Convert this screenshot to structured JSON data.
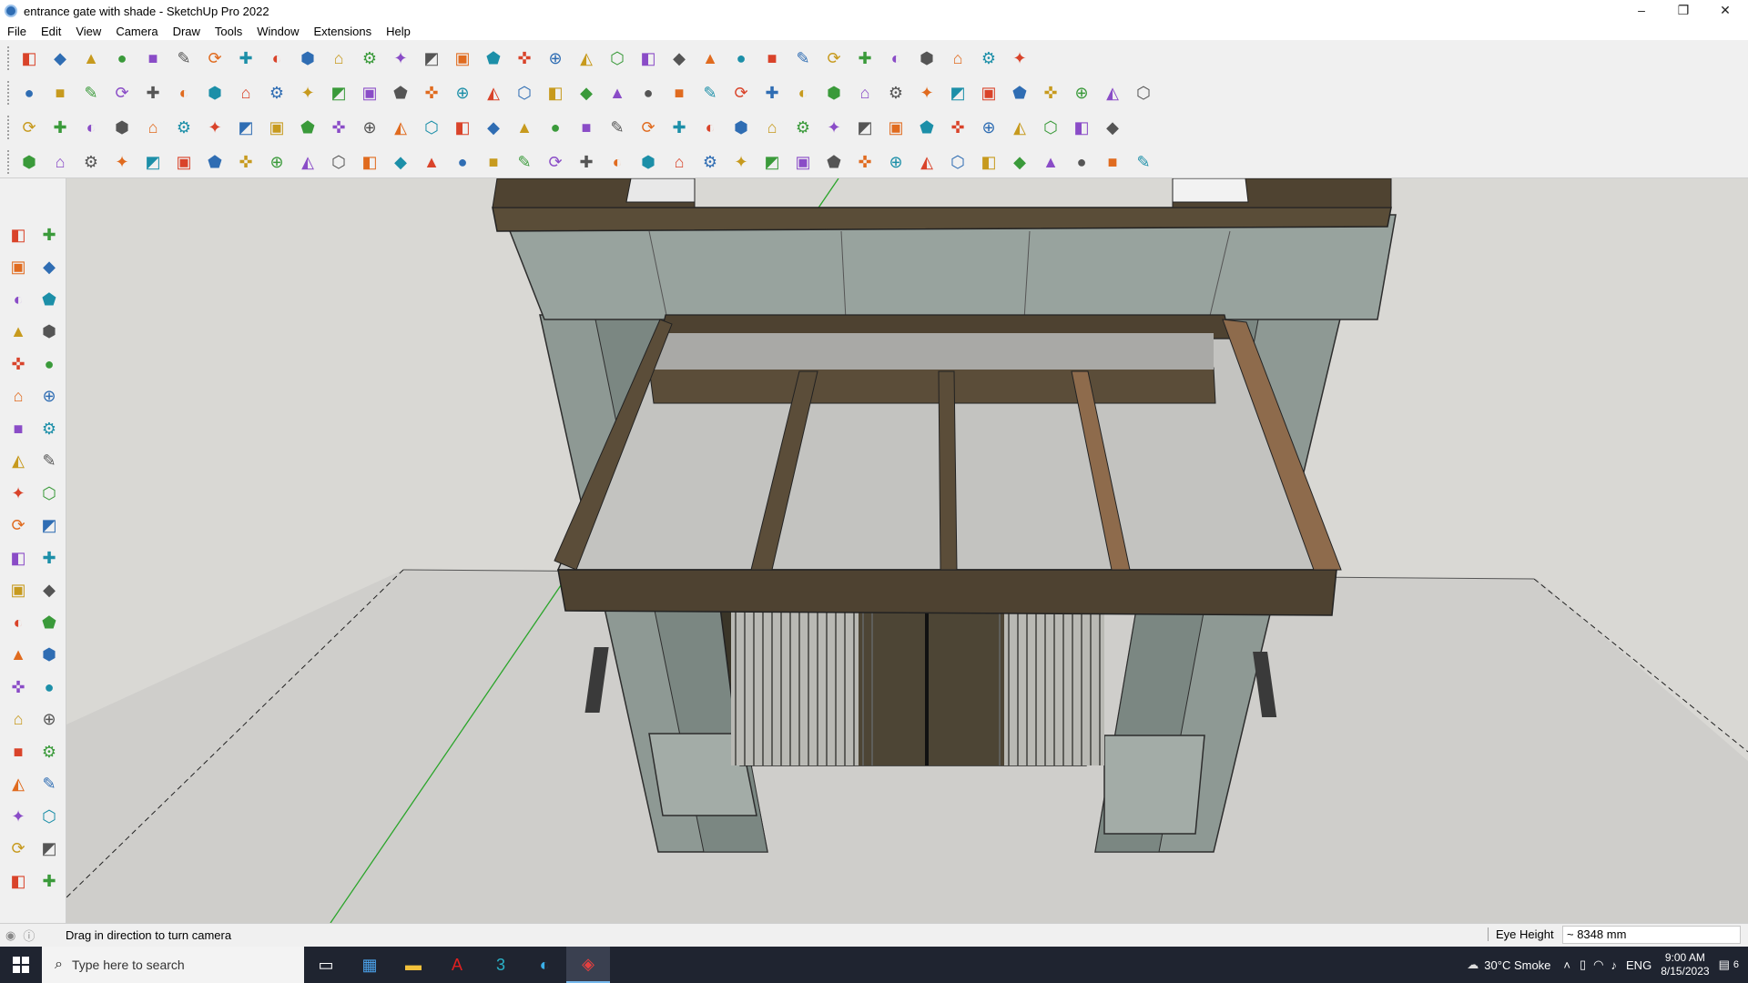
{
  "window": {
    "title": "entrance gate with shade - SketchUp Pro 2022",
    "minimize": "–",
    "maximize": "❐",
    "close": "✕"
  },
  "menu": [
    "File",
    "Edit",
    "View",
    "Camera",
    "Draw",
    "Tools",
    "Window",
    "Extensions",
    "Help"
  ],
  "toolbar_rows": [
    [
      "zoom-extents-icon",
      "select-icon",
      "eraser-icon",
      "pencil-icon",
      "lasso-icon",
      "paint-bucket-icon",
      "push-pull-icon",
      "follow-me-icon",
      "move-icon",
      "rotate-icon",
      "scale-icon",
      "tape-measure-icon",
      "text-icon",
      "paint-icon",
      "orbit-icon",
      "pan-icon",
      "zoom-icon",
      "zoom-window-icon",
      "section-icon",
      "layers-icon",
      "styles-icon",
      "scenes-icon",
      "user-icon",
      "warehouse-icon",
      "extension-warehouse-icon",
      "sandbox-icon",
      "flip-icon",
      "up-down-icon",
      "axes-icon",
      "dimension-icon",
      "undo-icon",
      "redo-icon",
      "hand-icon"
    ],
    [
      "box-icon",
      "component-icon",
      "group-icon",
      "solid-tools-icon",
      "union-icon",
      "subtract-icon",
      "intersect-icon",
      "trim-icon",
      "split-icon",
      "outer-shell-icon",
      "sandbox-from-contours-icon",
      "section-plane-icon",
      "section-cut-icon",
      "house-icon",
      "house-outline-icon",
      "garage-icon",
      "shed-icon",
      "grid-icon",
      "leaf-icon",
      "knife-icon",
      "curve-icon",
      "circle-icon",
      "polygon-icon",
      "ellipse-icon",
      "parallelogram-icon",
      "arc-icon",
      "bezier-icon",
      "lasso-select-icon",
      "paint-tool-icon",
      "magic-eraser-icon",
      "roof-icon",
      "grid-panel-icon",
      "stairs-icon",
      "fence-icon",
      "door-icon",
      "window-icon",
      "texture-icon"
    ],
    [
      "dimension-face-icon",
      "plane-icon",
      "hip-icon",
      "text-label-icon",
      "tag-icon",
      "frame-icon",
      "spring-icon",
      "box-frame-icon",
      "wall-icon",
      "wood-icon",
      "weld-icon",
      "bend-icon",
      "path-icon",
      "cross-icon",
      "add-cross-icon",
      "split-cross-icon",
      "triangle-icon",
      "tree-icon",
      "warning-icon",
      "loop-icon",
      "link-icon",
      "ring-icon",
      "joint-icon",
      "bucket-icon",
      "magnet-icon",
      "chart-block-icon",
      "bezier-curve-icon",
      "explode-icon",
      "group-explode-icon",
      "layer-block-icon",
      "tile-icon",
      "grid-hatch-icon",
      "grid-square-icon",
      "dots-icon",
      "corners-icon",
      "nodes-icon"
    ],
    [
      "polyline-icon",
      "spline-icon",
      "multi-select-icon",
      "cube-hole-icon",
      "cylinder-icon",
      "loft-icon",
      "sweep-icon",
      "curviloft-icon",
      "shell-icon",
      "extrude-icon",
      "offset-icon",
      "fillet-icon",
      "chamfer-icon",
      "slice-icon",
      "cutout-icon",
      "rail-icon",
      "comb-icon",
      "hatch-icon",
      "fins-icon",
      "deform-icon",
      "twist-icon",
      "stretch-icon",
      "bridge-icon",
      "taper-icon",
      "fold-icon",
      "cap-icon",
      "pillar-icon",
      "stripe-icon",
      "wave-icon",
      "fan-icon",
      "spiral-icon",
      "mesh-icon",
      "braid-icon",
      "sawtooth-icon",
      "ribbon-icon",
      "polygon-net-icon",
      "lattice-icon"
    ]
  ],
  "left_tools": [
    "select-tool-icon",
    "orbit-tool-icon",
    "paint-bucket-tool-icon",
    "eraser-tool-icon",
    "component-tool-icon",
    "tag-tool-icon",
    "line-tool-icon",
    "freehand-tool-icon",
    "rectangle-tool-icon",
    "rotated-rectangle-tool-icon",
    "circle-tool-icon",
    "polygon-tool-icon",
    "arc-tool-icon",
    "two-point-arc-tool-icon",
    "pie-tool-icon",
    "three-point-arc-tool-icon",
    "move-tool-icon",
    "push-pull-tool-icon",
    "rotate-tool-icon",
    "follow-me-tool-icon",
    "scale-tool-icon",
    "offset-tool-icon",
    "tape-measure-tool-icon",
    "dimension-tool-icon",
    "protractor-tool-icon",
    "text-tool-icon",
    "axes-tool-icon",
    "3d-text-tool-icon",
    "orbit-view-icon",
    "pan-view-icon",
    "zoom-view-icon",
    "zoom-window-view-icon",
    "zoom-extents-view-icon",
    "previous-view-icon",
    "position-camera-icon",
    "look-around-icon",
    "walk-icon",
    "section-plane-tool-icon",
    "section-display-icon",
    "section-fill-icon",
    "layers-display-icon",
    "styles-display-icon"
  ],
  "status": {
    "message": "Drag in direction to turn camera",
    "measure_label": "Eye Height",
    "measure_value": "~ 8348 mm"
  },
  "taskbar": {
    "search_placeholder": "Type here to search",
    "weather": "30°C  Smoke",
    "language": "ENG",
    "time": "9:00 AM",
    "date": "8/15/2023",
    "notifications": "6"
  },
  "colors": {
    "viewport_ground": "#d4d3cf",
    "wood_dark": "#4e4231",
    "wood_light": "#8e6b4c",
    "stone_panel": "#9aa59f",
    "taskbar": "#1f2430",
    "axis_green": "#2aa52a"
  }
}
